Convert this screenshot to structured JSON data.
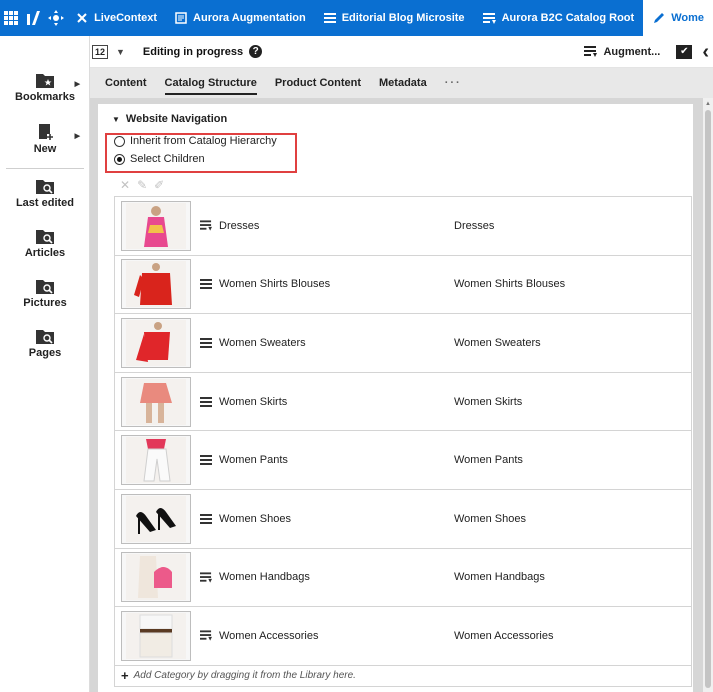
{
  "topbar": {
    "items": [
      {
        "label": "LiveContext",
        "icon": "tools-icon"
      },
      {
        "label": "Aurora Augmentation",
        "icon": "document-icon"
      },
      {
        "label": "Editorial Blog Microsite",
        "icon": "list-icon"
      },
      {
        "label": "Aurora B2C Catalog Root",
        "icon": "augmented-list-icon"
      },
      {
        "label": "Wome",
        "icon": "pencil-icon"
      }
    ]
  },
  "docbar": {
    "status": "Editing in progress",
    "help": "?",
    "augment_label": "Augment..."
  },
  "sidebar": {
    "items": [
      {
        "label": "Bookmarks"
      },
      {
        "label": "New"
      },
      {
        "label": "Last edited"
      },
      {
        "label": "Articles"
      },
      {
        "label": "Pictures"
      },
      {
        "label": "Pages"
      }
    ]
  },
  "tabs": [
    {
      "label": "Content"
    },
    {
      "label": "Catalog Structure"
    },
    {
      "label": "Product Content"
    },
    {
      "label": "Metadata"
    },
    {
      "label": "···"
    }
  ],
  "navigation": {
    "heading": "Website Navigation",
    "option_inherit": "Inherit from Catalog Hierarchy",
    "option_select": "Select Children",
    "selected": "Select Children"
  },
  "categories": [
    {
      "name": "Dresses",
      "name2": "Dresses",
      "type": "augmented"
    },
    {
      "name": "Women Shirts Blouses",
      "name2": "Women Shirts Blouses",
      "type": "plain"
    },
    {
      "name": "Women Sweaters",
      "name2": "Women Sweaters",
      "type": "plain"
    },
    {
      "name": "Women Skirts",
      "name2": "Women Skirts",
      "type": "plain"
    },
    {
      "name": "Women Pants",
      "name2": "Women Pants",
      "type": "plain"
    },
    {
      "name": "Women Shoes",
      "name2": "Women Shoes",
      "type": "plain"
    },
    {
      "name": "Women Handbags",
      "name2": "Women Handbags",
      "type": "augmented"
    },
    {
      "name": "Women Accessories",
      "name2": "Women Accessories",
      "type": "augmented"
    }
  ],
  "add_hint": "Add Category by dragging it from the Library here.",
  "colors": {
    "brand": "#0a6fd1",
    "highlight": "#e04040"
  }
}
